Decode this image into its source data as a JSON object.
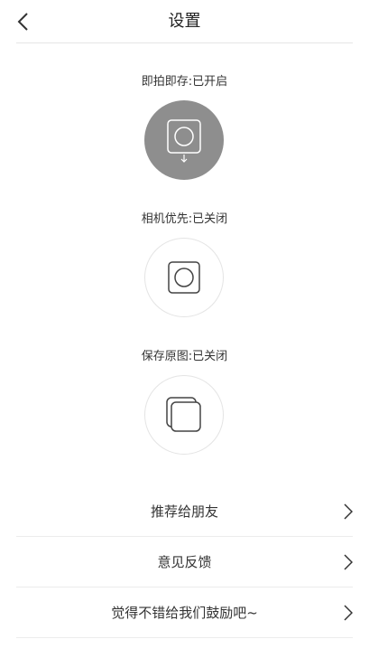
{
  "header": {
    "title": "设置",
    "back_icon": "chevron-left-icon"
  },
  "options": [
    {
      "label": "即拍即存:已开启",
      "state": "on",
      "icon": "camera-save-icon"
    },
    {
      "label": "相机优先:已关闭",
      "state": "off",
      "icon": "camera-icon"
    },
    {
      "label": "保存原图:已关闭",
      "state": "off",
      "icon": "original-image-icon"
    }
  ],
  "menu": [
    {
      "label": "推荐给朋友",
      "icon": "chevron-right-icon"
    },
    {
      "label": "意见反馈",
      "icon": "chevron-right-icon"
    },
    {
      "label": "觉得不错给我们鼓励吧~",
      "icon": "chevron-right-icon"
    }
  ],
  "colors": {
    "active_circle": "#8e8e8e",
    "divider": "#ececec",
    "text": "#333333"
  }
}
